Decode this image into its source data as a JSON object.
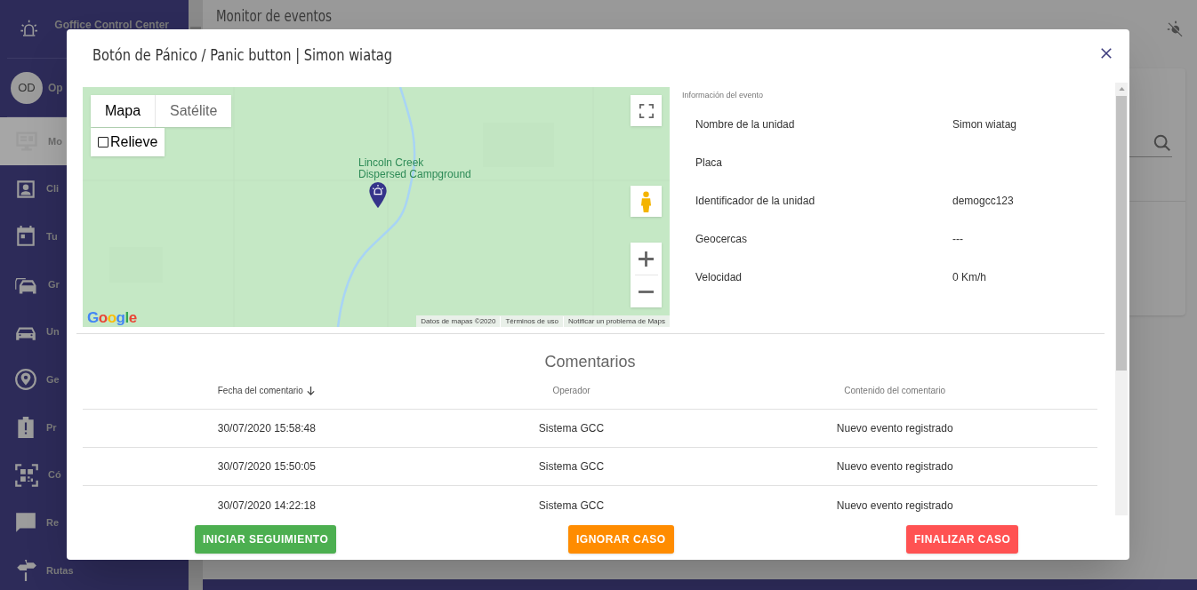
{
  "sidebar": {
    "brand": "Goffice Control Center",
    "user": {
      "initials": "OD",
      "name": "Op"
    },
    "items": [
      {
        "label": "Mo",
        "selected": true
      },
      {
        "label": "Cli",
        "selected": false
      },
      {
        "label": "Tu",
        "selected": false
      },
      {
        "label": "Gr",
        "selected": false
      },
      {
        "label": "Un",
        "selected": false
      },
      {
        "label": "Ge",
        "selected": false
      },
      {
        "label": "Pr",
        "selected": false
      },
      {
        "label": "Có",
        "selected": false
      },
      {
        "label": "Re",
        "selected": false
      },
      {
        "label": "Rutas",
        "selected": false
      }
    ]
  },
  "header": {
    "title": "Monitor de eventos"
  },
  "modal": {
    "title": "Botón de Pánico / Panic button | Simon wiatag",
    "map": {
      "type_tabs": [
        {
          "label": "Mapa",
          "selected": true
        },
        {
          "label": "Satélite",
          "selected": false
        }
      ],
      "relief": {
        "label": "Relieve",
        "checked": false
      },
      "place_label": [
        "Lincoln Creek",
        "Dispersed Campground"
      ],
      "logo": "Google",
      "attribution": [
        "Datos de mapas ©2020",
        "Términos de uso",
        "Notificar un problema de Maps"
      ]
    },
    "info": {
      "title": "Información del evento",
      "rows": [
        {
          "label": "Nombre de la unidad",
          "value": "Simon wiatag"
        },
        {
          "label": "Placa"
        },
        {
          "label": "Identificador de la unidad",
          "value": "demogcc123"
        },
        {
          "label": "Geocercas",
          "value": "---"
        },
        {
          "label": "Velocidad",
          "value": "0 Km/h"
        }
      ]
    },
    "comments": {
      "title": "Comentarios",
      "columns": [
        {
          "label": "Fecha del comentario",
          "sorted": true
        },
        {
          "label": "Operador",
          "sorted": false
        },
        {
          "label": "Contenido del comentario",
          "sorted": false
        }
      ],
      "rows": [
        [
          "30/07/2020 15:58:48",
          "Sistema GCC",
          "Nuevo evento registrado"
        ],
        [
          "30/07/2020 15:50:05",
          "Sistema GCC",
          "Nuevo evento registrado"
        ],
        [
          "30/07/2020 14:22:18",
          "Sistema GCC",
          "Nuevo evento registrado"
        ]
      ]
    },
    "buttons": [
      {
        "label": "INICIAR SEGUIMIENTO",
        "color": "#4caf50"
      },
      {
        "label": "IGNORAR CASO",
        "color": "#ff8c00"
      },
      {
        "label": "FINALIZAR CASO",
        "color": "#ff5252"
      }
    ]
  }
}
